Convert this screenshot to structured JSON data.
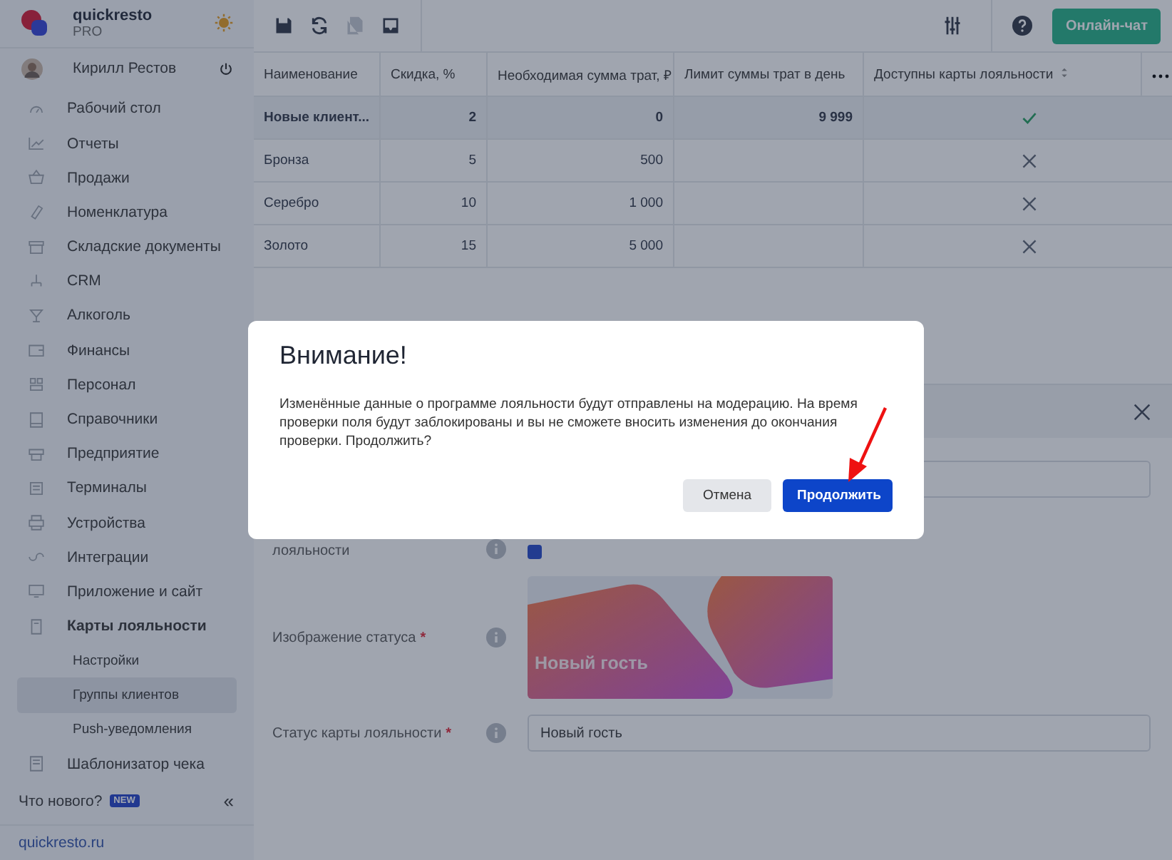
{
  "sidebar": {
    "brand": {
      "name": "quickresto",
      "plan": "PRO"
    },
    "user": {
      "name": "Кирилл Рестов"
    },
    "items": [
      {
        "label": "Рабочий стол",
        "expanded": false
      },
      {
        "label": "Отчеты",
        "expanded": false
      },
      {
        "label": "Продажи",
        "expanded": false
      },
      {
        "label": "Номенклатура",
        "expanded": false
      },
      {
        "label": "Складские документы",
        "expanded": false
      },
      {
        "label": "CRM",
        "expanded": false
      },
      {
        "label": "Алкоголь",
        "expanded": false
      },
      {
        "label": "Финансы",
        "expanded": false
      },
      {
        "label": "Персонал",
        "expanded": false
      },
      {
        "label": "Справочники",
        "expanded": false
      },
      {
        "label": "Предприятие",
        "expanded": false
      },
      {
        "label": "Терминалы",
        "expanded": false
      },
      {
        "label": "Устройства",
        "expanded": false
      },
      {
        "label": "Интеграции",
        "expanded": false
      },
      {
        "label": "Приложение и сайт",
        "expanded": false
      },
      {
        "label": "Карты лояльности",
        "expanded": true,
        "children": [
          {
            "label": "Настройки",
            "selected": false
          },
          {
            "label": "Группы клиентов",
            "selected": true
          },
          {
            "label": "Push-уведомления",
            "selected": false
          }
        ]
      },
      {
        "label": "Шаблонизатор чека",
        "expanded": false
      }
    ],
    "whats_new": "Что нового?",
    "badge": "NEW",
    "collapse": "«",
    "link": "quickresto.ru"
  },
  "toolbar": {
    "tools": [
      {
        "disabled": false
      },
      {
        "disabled": false
      },
      {
        "disabled": true
      },
      {
        "disabled": false
      }
    ],
    "chat_button": "Онлайн-чат"
  },
  "table": {
    "columns": [
      "Наименование",
      "Скидка, %",
      "Необходимая сумма трат, ₽",
      "Лимит суммы трат в день",
      "Доступны карты лояльности"
    ],
    "rows": [
      {
        "name": "Новые клиент...",
        "discount": "2",
        "min_sum": "0",
        "limit": "9 999",
        "loyalty_cards": true,
        "selected": true
      },
      {
        "name": "Бронза",
        "discount": "5",
        "min_sum": "500",
        "loyalty_cards": false,
        "selected": false
      },
      {
        "name": "Серебро",
        "discount": "10",
        "min_sum": "1 000",
        "loyalty_cards": false,
        "selected": false
      },
      {
        "name": "Золото",
        "discount": "15",
        "min_sum": "5 000",
        "loyalty_cards": false,
        "selected": false
      }
    ]
  },
  "detail_panel": {
    "fields": [
      {
        "kind": "input"
      },
      {
        "kind": "checkbox",
        "label": "лояльности",
        "checked": true
      },
      {
        "kind": "image",
        "label": "Изображение статуса",
        "required_mark": "*",
        "caption": "Новый гость"
      },
      {
        "kind": "input",
        "label": "Статус карты лояльности",
        "required_mark": "*",
        "value": "Новый гость"
      }
    ]
  },
  "dialog": {
    "title": "Внимание!",
    "message": "Изменённые данные о программе лояльности будут отправлены на модерацию. На время проверки поля будут заблокированы и вы не сможете вносить изменения до окончания проверки. Продолжить?",
    "buttons": [
      {
        "label": "Отмена",
        "kind": "secondary"
      },
      {
        "label": "Продолжить",
        "kind": "primary"
      }
    ]
  }
}
